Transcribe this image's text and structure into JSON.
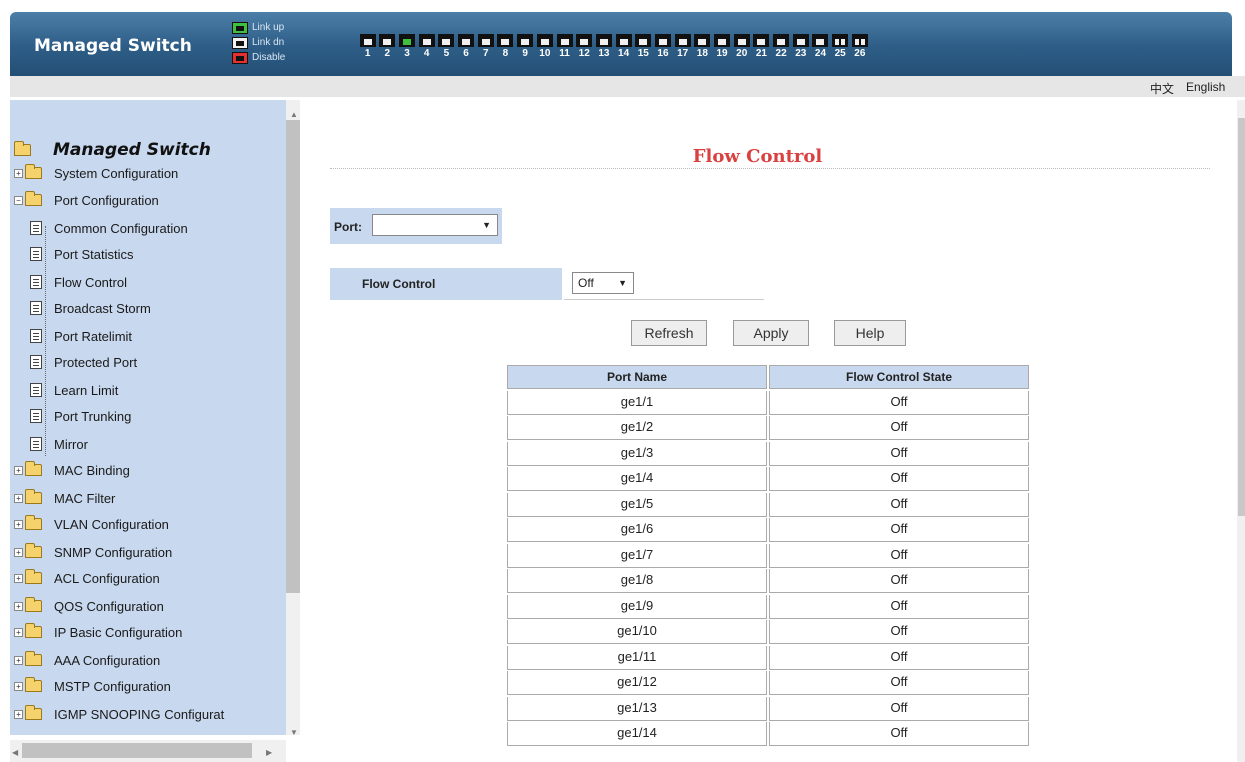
{
  "header": {
    "brand": "Managed Switch",
    "legend": [
      {
        "label": "Link up",
        "state": "up"
      },
      {
        "label": "Link dn",
        "state": "dn"
      },
      {
        "label": "Disable",
        "state": "dis"
      }
    ],
    "ports": [
      {
        "num": "1",
        "state": "dn"
      },
      {
        "num": "2",
        "state": "dn"
      },
      {
        "num": "3",
        "state": "up"
      },
      {
        "num": "4",
        "state": "dn"
      },
      {
        "num": "5",
        "state": "dn"
      },
      {
        "num": "6",
        "state": "dn"
      },
      {
        "num": "7",
        "state": "dn"
      },
      {
        "num": "8",
        "state": "dn"
      },
      {
        "num": "9",
        "state": "dn"
      },
      {
        "num": "10",
        "state": "dn"
      },
      {
        "num": "11",
        "state": "dn"
      },
      {
        "num": "12",
        "state": "dn"
      },
      {
        "num": "13",
        "state": "dn"
      },
      {
        "num": "14",
        "state": "dn"
      },
      {
        "num": "15",
        "state": "dn"
      },
      {
        "num": "16",
        "state": "dn"
      },
      {
        "num": "17",
        "state": "dn"
      },
      {
        "num": "18",
        "state": "dn"
      },
      {
        "num": "19",
        "state": "dn"
      },
      {
        "num": "20",
        "state": "dn"
      },
      {
        "num": "21",
        "state": "dn"
      },
      {
        "num": "22",
        "state": "dn"
      },
      {
        "num": "23",
        "state": "dn"
      },
      {
        "num": "24",
        "state": "dn"
      },
      {
        "num": "25",
        "state": "fiber"
      },
      {
        "num": "26",
        "state": "fiber"
      }
    ],
    "colors": {
      "link_up": "#3fbf3f",
      "disable": "#e53030",
      "header_bg": "#2d5d86"
    }
  },
  "langbar": {
    "zh": "中文",
    "en": "English"
  },
  "sidebar": {
    "root": "Managed Switch",
    "items": [
      {
        "label": "System Configuration"
      },
      {
        "label": "Port Configuration"
      },
      {
        "label": "Common Configuration"
      },
      {
        "label": "Port Statistics"
      },
      {
        "label": "Flow Control"
      },
      {
        "label": "Broadcast Storm"
      },
      {
        "label": "Port Ratelimit"
      },
      {
        "label": "Protected Port"
      },
      {
        "label": "Learn Limit"
      },
      {
        "label": "Port Trunking"
      },
      {
        "label": "Mirror"
      },
      {
        "label": "MAC Binding"
      },
      {
        "label": "MAC Filter"
      },
      {
        "label": "VLAN Configuration"
      },
      {
        "label": "SNMP Configuration"
      },
      {
        "label": "ACL Configuration"
      },
      {
        "label": "QOS Configuration"
      },
      {
        "label": "IP Basic Configuration"
      },
      {
        "label": "AAA Configuration"
      },
      {
        "label": "MSTP Configuration"
      },
      {
        "label": "IGMP SNOOPING Configurat"
      }
    ]
  },
  "main": {
    "title": "Flow Control",
    "port_label": "Port:",
    "port_value": "",
    "flow_control_label": "Flow Control",
    "flow_control_value": "Off",
    "buttons": {
      "refresh": "Refresh",
      "apply": "Apply",
      "help": "Help"
    },
    "table": {
      "headers": [
        "Port Name",
        "Flow Control State"
      ],
      "rows": [
        [
          "ge1/1",
          "Off"
        ],
        [
          "ge1/2",
          "Off"
        ],
        [
          "ge1/3",
          "Off"
        ],
        [
          "ge1/4",
          "Off"
        ],
        [
          "ge1/5",
          "Off"
        ],
        [
          "ge1/6",
          "Off"
        ],
        [
          "ge1/7",
          "Off"
        ],
        [
          "ge1/8",
          "Off"
        ],
        [
          "ge1/9",
          "Off"
        ],
        [
          "ge1/10",
          "Off"
        ],
        [
          "ge1/11",
          "Off"
        ],
        [
          "ge1/12",
          "Off"
        ],
        [
          "ge1/13",
          "Off"
        ],
        [
          "ge1/14",
          "Off"
        ]
      ]
    }
  }
}
